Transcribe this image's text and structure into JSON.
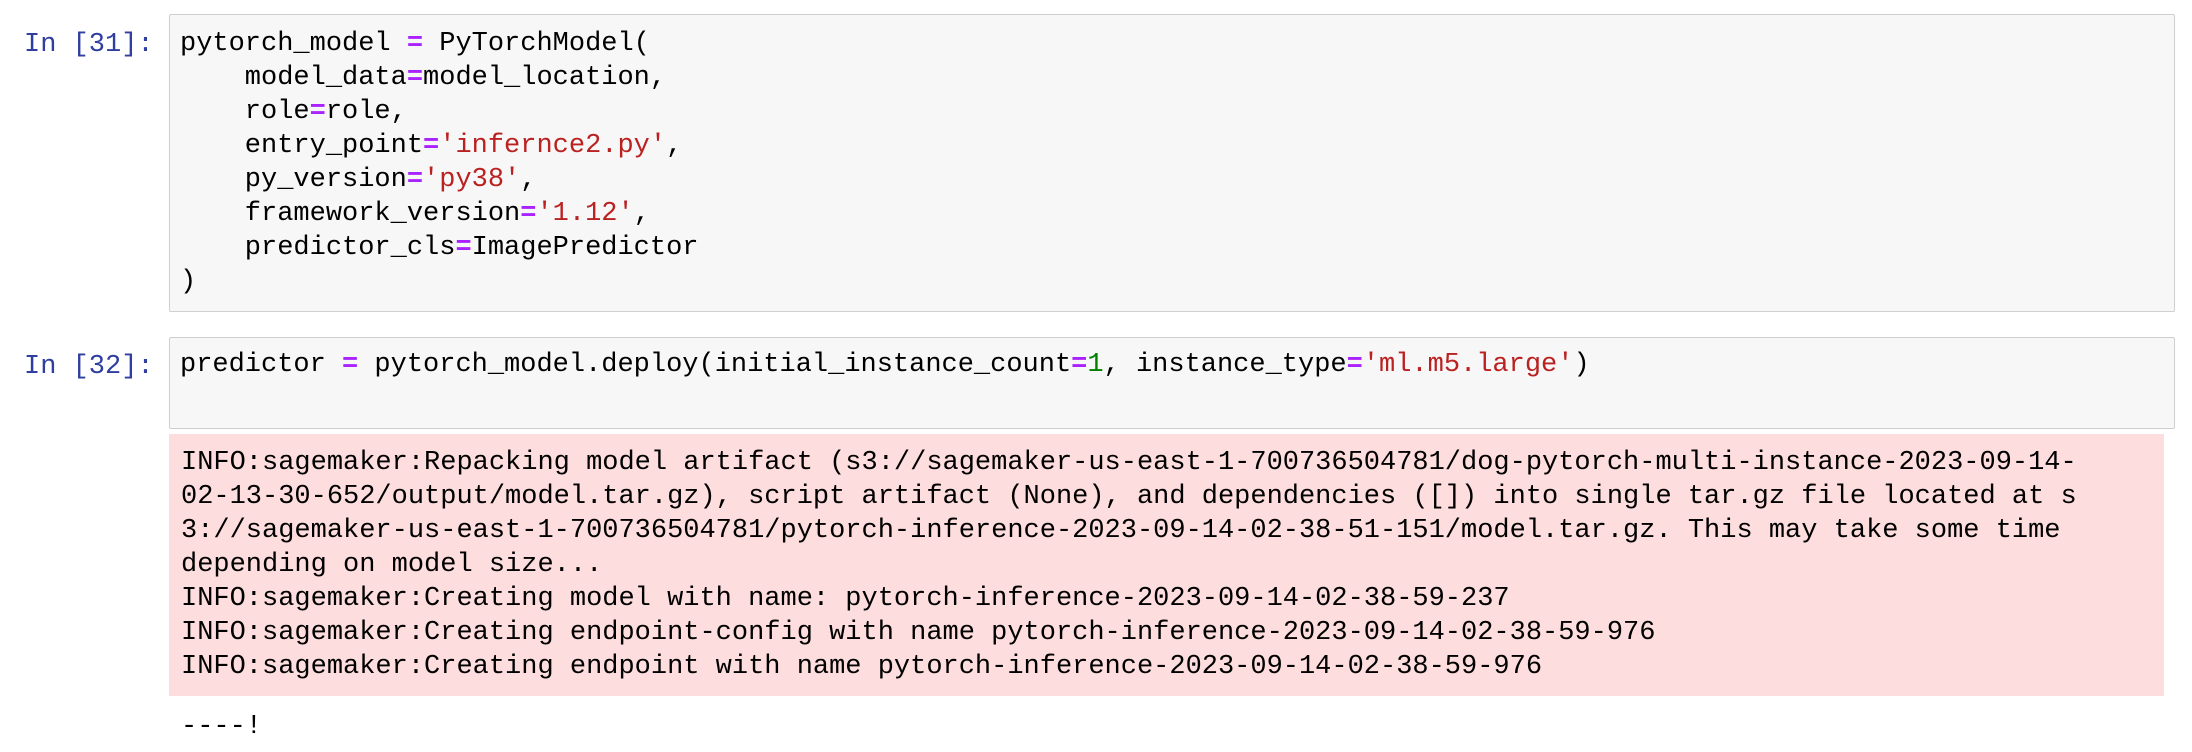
{
  "cells": [
    {
      "prompt": "In [31]:",
      "code_lines": [
        [
          {
            "t": "pytorch_model "
          },
          {
            "t": "=",
            "k": "op"
          },
          {
            "t": " PyTorchModel("
          }
        ],
        [
          {
            "t": "    model_data"
          },
          {
            "t": "=",
            "k": "op"
          },
          {
            "t": "model_location,"
          }
        ],
        [
          {
            "t": "    role"
          },
          {
            "t": "=",
            "k": "op"
          },
          {
            "t": "role,"
          }
        ],
        [
          {
            "t": "    entry_point"
          },
          {
            "t": "=",
            "k": "op"
          },
          {
            "t": "'infernce2.py'",
            "k": "str"
          },
          {
            "t": ","
          }
        ],
        [
          {
            "t": "    py_version"
          },
          {
            "t": "=",
            "k": "op"
          },
          {
            "t": "'py38'",
            "k": "str"
          },
          {
            "t": ","
          }
        ],
        [
          {
            "t": "    framework_version"
          },
          {
            "t": "=",
            "k": "op"
          },
          {
            "t": "'1.12'",
            "k": "str"
          },
          {
            "t": ","
          }
        ],
        [
          {
            "t": "    predictor_cls"
          },
          {
            "t": "=",
            "k": "op"
          },
          {
            "t": "ImagePredictor"
          }
        ],
        [
          {
            "t": ")"
          }
        ]
      ]
    },
    {
      "prompt": "In [32]:",
      "code_lines": [
        [
          {
            "t": "predictor "
          },
          {
            "t": "=",
            "k": "op"
          },
          {
            "t": " pytorch_model.deploy(initial_instance_count"
          },
          {
            "t": "=",
            "k": "op"
          },
          {
            "t": "1",
            "k": "num"
          },
          {
            "t": ", instance_type"
          },
          {
            "t": "=",
            "k": "op"
          },
          {
            "t": "'ml.m5.large'",
            "k": "str"
          },
          {
            "t": ")"
          }
        ]
      ],
      "stderr_lines": [
        "INFO:sagemaker:Repacking model artifact (s3://sagemaker-us-east-1-700736504781/dog-pytorch-multi-instance-2023-09-14-",
        "02-13-30-652/output/model.tar.gz), script artifact (None), and dependencies ([]) into single tar.gz file located at s",
        "3://sagemaker-us-east-1-700736504781/pytorch-inference-2023-09-14-02-38-51-151/model.tar.gz. This may take some time",
        "depending on model size...",
        "INFO:sagemaker:Creating model with name: pytorch-inference-2023-09-14-02-38-59-237",
        "INFO:sagemaker:Creating endpoint-config with name pytorch-inference-2023-09-14-02-38-59-976",
        "INFO:sagemaker:Creating endpoint with name pytorch-inference-2023-09-14-02-38-59-976"
      ],
      "stdout": "----!"
    }
  ]
}
